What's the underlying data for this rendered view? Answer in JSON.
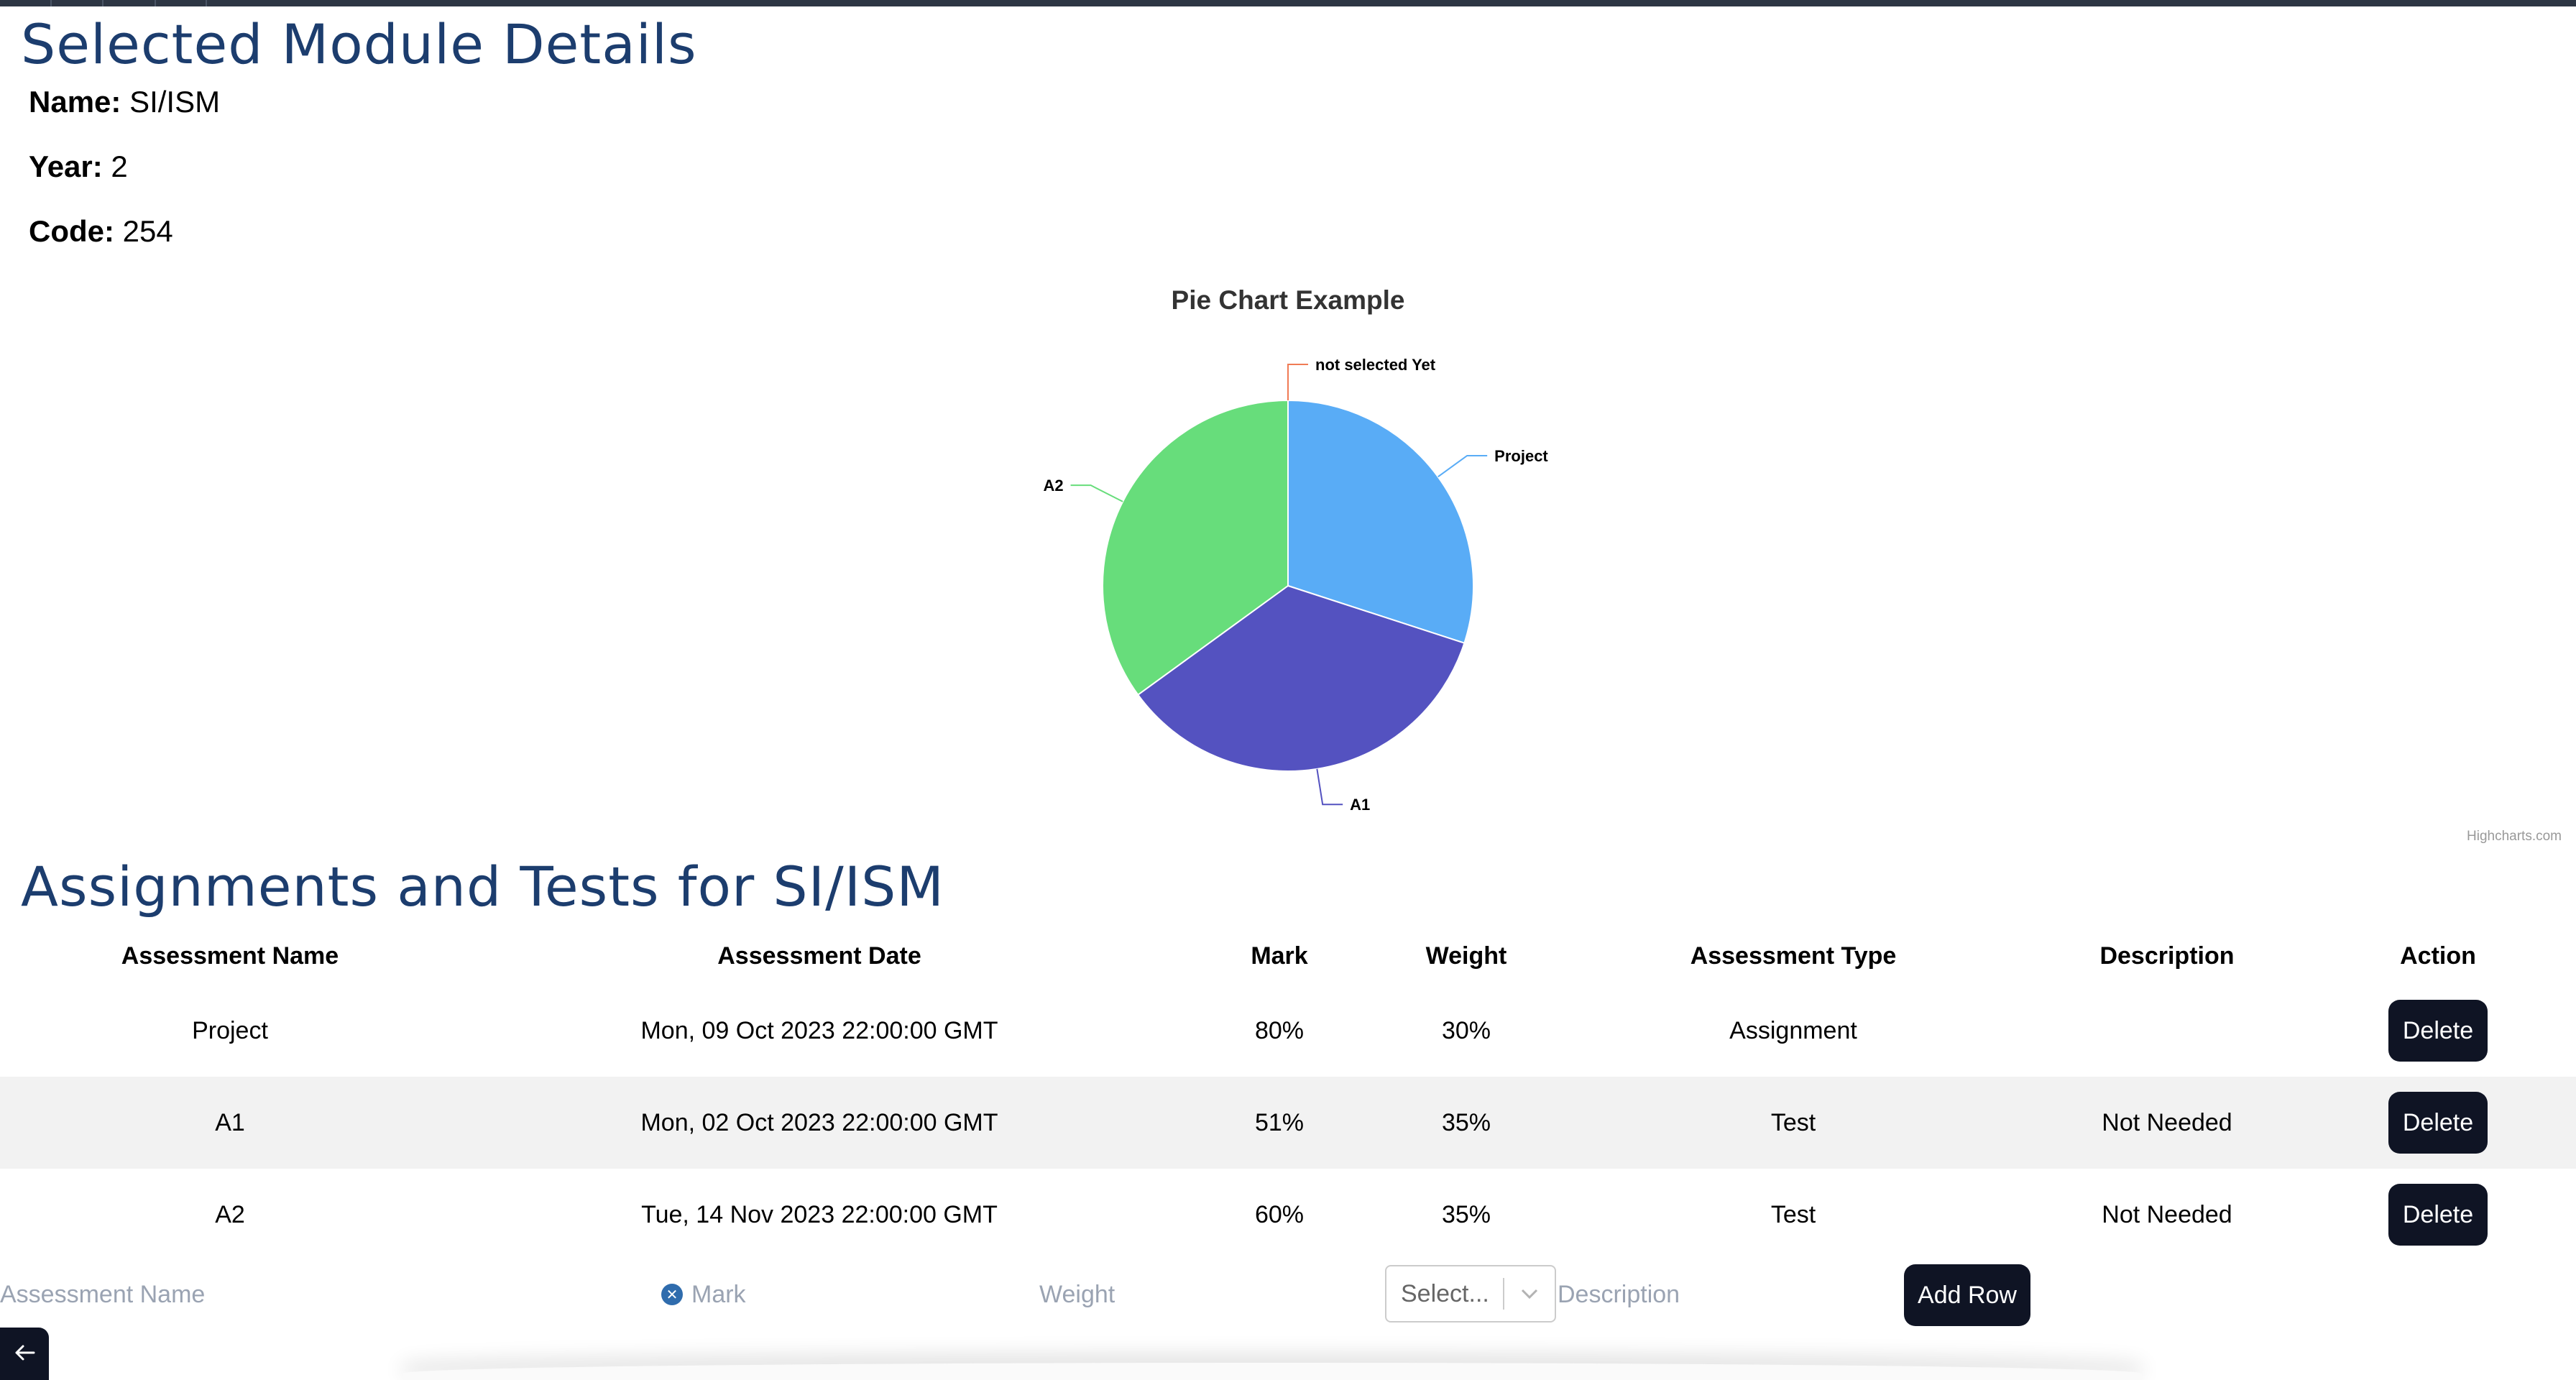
{
  "page": {
    "title": "Selected Module Details",
    "assessments_title": "Assignments and Tests for SI/ISM"
  },
  "module": {
    "name_label": "Name:",
    "name": "SI/ISM",
    "year_label": "Year:",
    "year": "2",
    "code_label": "Code:",
    "code": "254"
  },
  "chart_data": {
    "type": "pie",
    "title": "Pie Chart Example",
    "credits": "Highcharts.com",
    "series": [
      {
        "name": "not selected Yet",
        "value": 0,
        "color": "#f07b55"
      },
      {
        "name": "Project",
        "value": 30,
        "color": "#59acf6"
      },
      {
        "name": "A1",
        "value": 35,
        "color": "#5452c0"
      },
      {
        "name": "A2",
        "value": 35,
        "color": "#67dd7b"
      }
    ]
  },
  "table": {
    "headers": [
      "Assessment Name",
      "Assessment Date",
      "Mark",
      "Weight",
      "Assessment Type",
      "Description",
      "Action"
    ],
    "rows": [
      {
        "name": "Project",
        "date": "Mon, 09 Oct 2023 22:00:00 GMT",
        "mark": "80%",
        "weight": "30%",
        "type": "Assignment",
        "description": "",
        "action": "Delete"
      },
      {
        "name": "A1",
        "date": "Mon, 02 Oct 2023 22:00:00 GMT",
        "mark": "51%",
        "weight": "35%",
        "type": "Test",
        "description": "Not Needed",
        "action": "Delete"
      },
      {
        "name": "A2",
        "date": "Tue, 14 Nov 2023 22:00:00 GMT",
        "mark": "60%",
        "weight": "35%",
        "type": "Test",
        "description": "Not Needed",
        "action": "Delete"
      }
    ]
  },
  "form": {
    "name_placeholder": "Assessment Name",
    "mark_placeholder": "Mark",
    "weight_placeholder": "Weight",
    "type_select": "Select...",
    "description_placeholder": "Description",
    "add_label": "Add Row"
  },
  "icons": {
    "clear": "close-circle-icon",
    "dropdown": "chevron-down-icon",
    "back": "arrow-left-icon"
  },
  "colors": {
    "heading": "#1c3d6e",
    "button": "#0f1424",
    "row_alt": "#f2f2f2"
  }
}
